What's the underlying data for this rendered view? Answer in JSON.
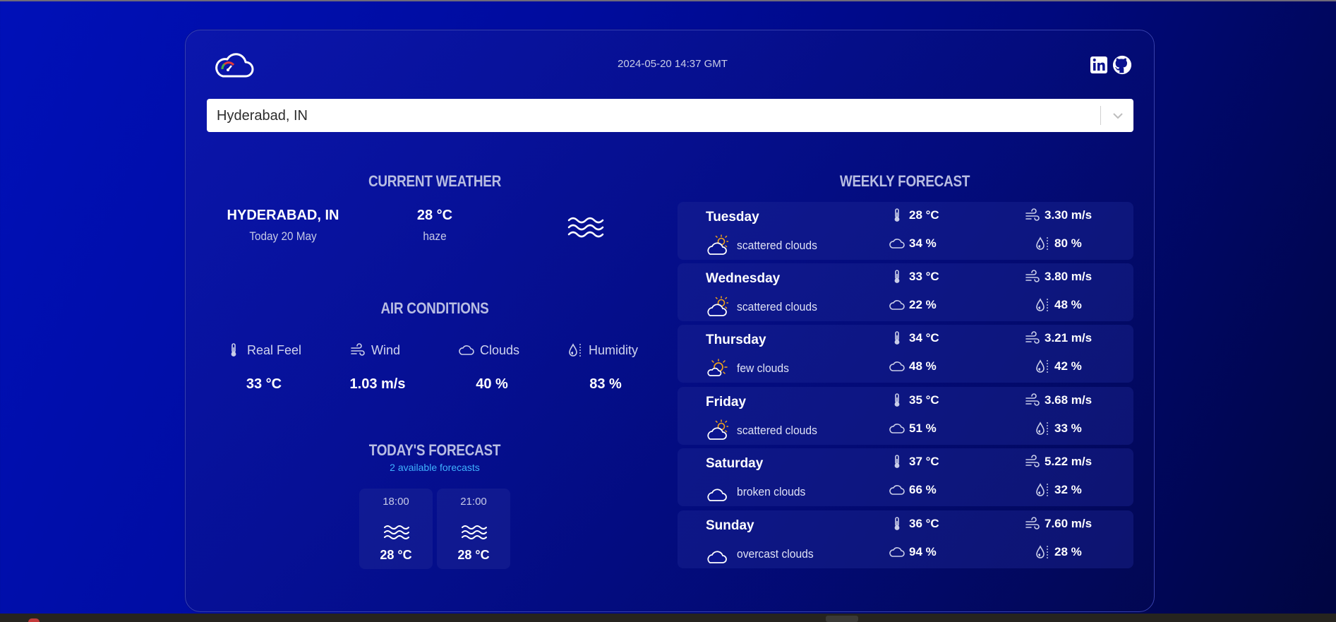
{
  "header": {
    "datetime": "2024-05-20 14:37 GMT",
    "social": [
      "linkedin-icon",
      "github-icon"
    ]
  },
  "search": {
    "value": "Hyderabad, IN"
  },
  "current": {
    "title": "CURRENT WEATHER",
    "city": "HYDERABAD, IN",
    "date": "Today 20 May",
    "temp": "28 °C",
    "description": "haze",
    "icon": "haze-icon"
  },
  "air": {
    "title": "AIR CONDITIONS",
    "items": [
      {
        "label": "Real Feel",
        "value": "33 °C",
        "icon": "thermometer-icon"
      },
      {
        "label": "Wind",
        "value": "1.03 m/s",
        "icon": "wind-icon"
      },
      {
        "label": "Clouds",
        "value": "40 %",
        "icon": "cloud-icon"
      },
      {
        "label": "Humidity",
        "value": "83 %",
        "icon": "humidity-icon"
      }
    ]
  },
  "today": {
    "title": "TODAY'S FORECAST",
    "subtitle": "2 available forecasts",
    "items": [
      {
        "time": "18:00",
        "temp": "28 °C",
        "icon": "haze-icon"
      },
      {
        "time": "21:00",
        "temp": "28 °C",
        "icon": "haze-icon"
      }
    ]
  },
  "weekly": {
    "title": "WEEKLY FORECAST",
    "days": [
      {
        "day": "Tuesday",
        "desc": "scattered clouds",
        "icon": "partly-cloudy-icon",
        "temp": "28 °C",
        "wind": "3.30 m/s",
        "clouds": "34 %",
        "humidity": "80 %"
      },
      {
        "day": "Wednesday",
        "desc": "scattered clouds",
        "icon": "partly-cloudy-icon",
        "temp": "33 °C",
        "wind": "3.80 m/s",
        "clouds": "22 %",
        "humidity": "48 %"
      },
      {
        "day": "Thursday",
        "desc": "few clouds",
        "icon": "sun-cloud-icon",
        "temp": "34 °C",
        "wind": "3.21 m/s",
        "clouds": "48 %",
        "humidity": "42 %"
      },
      {
        "day": "Friday",
        "desc": "scattered clouds",
        "icon": "partly-cloudy-icon",
        "temp": "35 °C",
        "wind": "3.68 m/s",
        "clouds": "51 %",
        "humidity": "33 %"
      },
      {
        "day": "Saturday",
        "desc": "broken clouds",
        "icon": "cloud-icon",
        "temp": "37 °C",
        "wind": "5.22 m/s",
        "clouds": "66 %",
        "humidity": "32 %"
      },
      {
        "day": "Sunday",
        "desc": "overcast clouds",
        "icon": "cloud-icon",
        "temp": "36 °C",
        "wind": "7.60 m/s",
        "clouds": "94 %",
        "humidity": "28 %"
      }
    ]
  },
  "colors": {
    "accent": "#3fb2ff",
    "card_bg": "#0b148f",
    "page_bg": "#000c9e"
  }
}
